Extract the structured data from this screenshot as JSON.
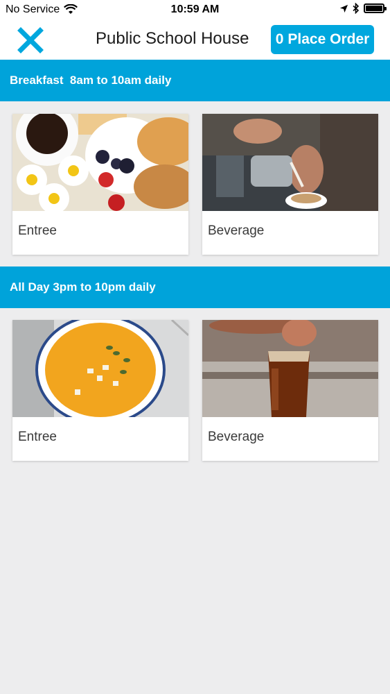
{
  "status_bar": {
    "carrier": "No Service",
    "time": "10:59 AM"
  },
  "header": {
    "title": "Public School House",
    "order_count": "0",
    "order_label": "Place Order",
    "accent_color": "#00a7de"
  },
  "sections": [
    {
      "title": "Breakfast  8am to 10am daily",
      "items": [
        {
          "label": "Entree",
          "image": "breakfast-pastries-photo"
        },
        {
          "label": "Beverage",
          "image": "latte-pour-photo"
        }
      ]
    },
    {
      "title": "All Day 3pm to 10pm daily",
      "items": [
        {
          "label": "Entree",
          "image": "pumpkin-soup-photo"
        },
        {
          "label": "Beverage",
          "image": "beer-glass-photo"
        }
      ]
    }
  ]
}
